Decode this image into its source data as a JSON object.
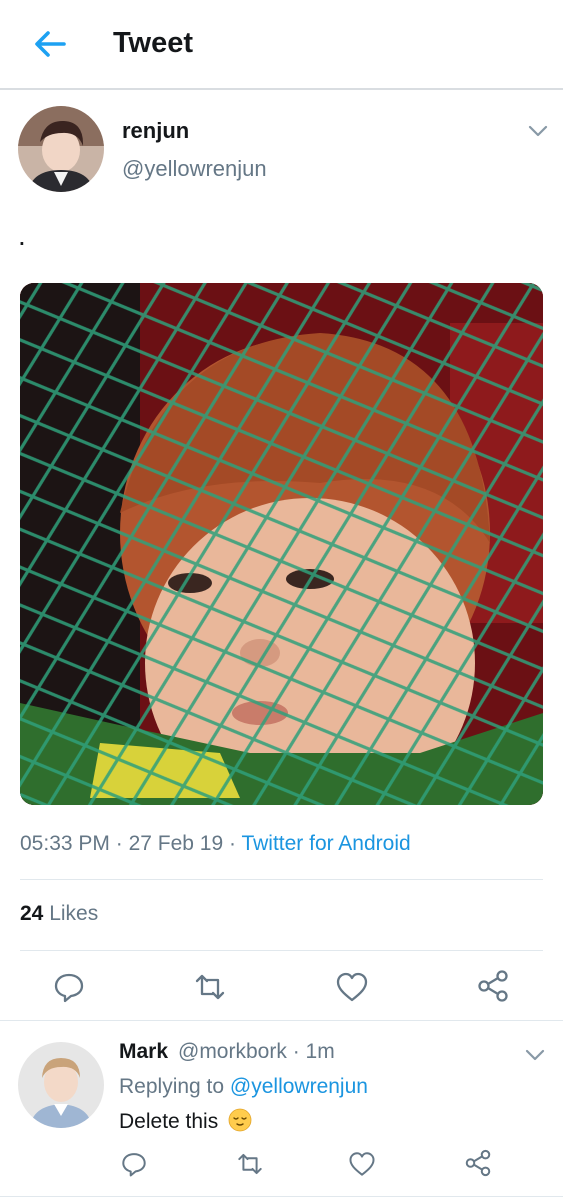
{
  "header": {
    "title": "Tweet",
    "back_icon": "arrow-left-icon",
    "accent": "#1da1f2"
  },
  "tweet": {
    "author_name": "renjun",
    "author_handle": "@yellowrenjun",
    "text": ".",
    "time": "05:33 PM",
    "date": "27 Feb 19",
    "source": "Twitter for Android",
    "likes_count": "24",
    "likes_label": "Likes",
    "actions": [
      "reply-icon",
      "retweet-icon",
      "like-icon",
      "share-icon"
    ]
  },
  "reply": {
    "author_name": "Mark",
    "author_handle": "@morkbork",
    "time": "1m",
    "replying_prefix": "Replying to",
    "replying_to": "@yellowrenjun",
    "text": "Delete this",
    "emoji_icon": "relieved-face-icon"
  },
  "colors": {
    "link": "#1b95e0",
    "muted": "#657786",
    "text": "#14171a",
    "divider": "#e1e8ed"
  }
}
